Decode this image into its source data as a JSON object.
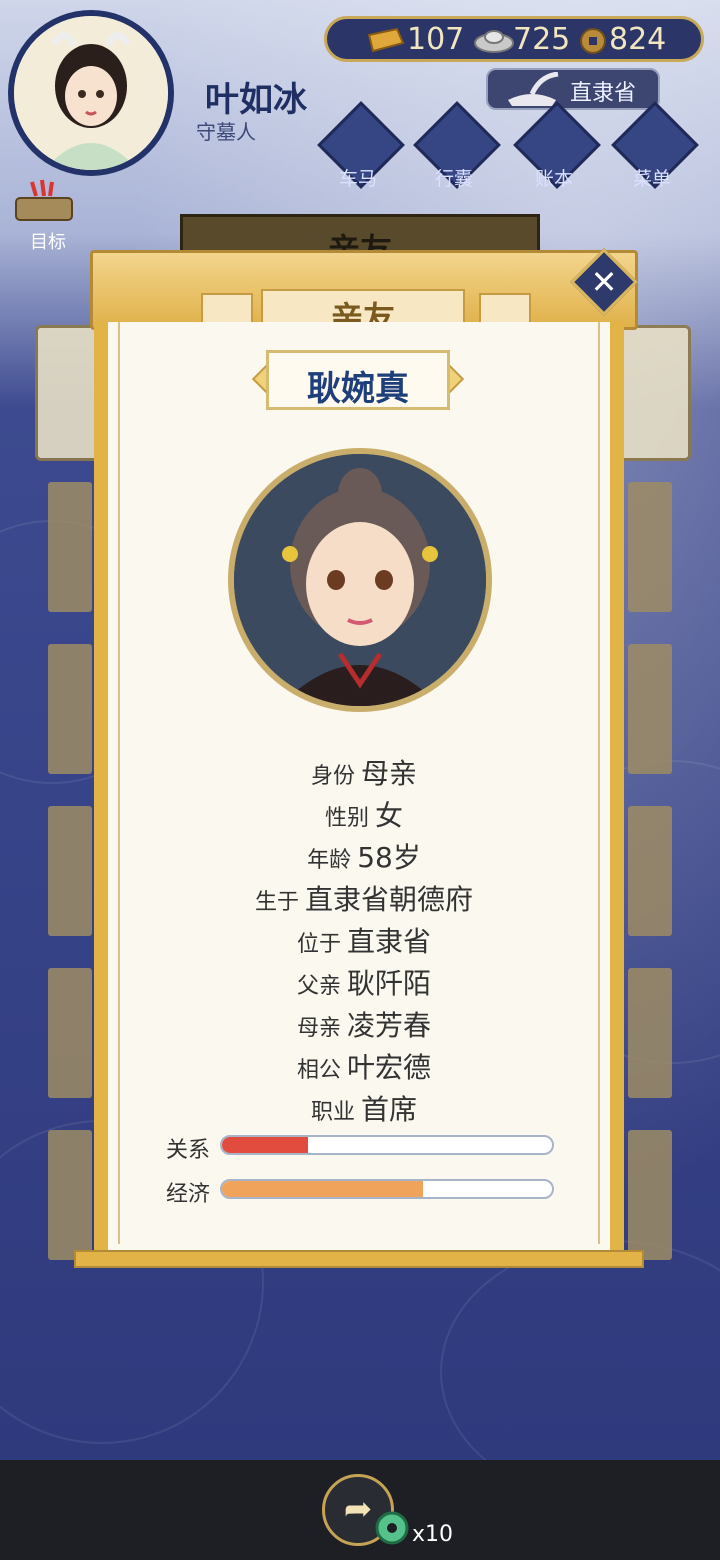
{
  "colors": {
    "background_top": "#cfd6ea",
    "background_deep": "#2f3a7d",
    "bottom_bar": "#1d1f24",
    "modal_gold": "#e2b448",
    "paper": "#fbf8ef",
    "relation_bar": "#e14c3f",
    "economy_bar": "#f0a35b"
  },
  "player": {
    "name": "叶如冰",
    "role": "守墓人",
    "avatar_icon": "player-avatar-portrait"
  },
  "currency": {
    "gold": "107",
    "silver": "725",
    "coins": "824",
    "gold_icon": "gold-bar-icon",
    "silver_icon": "silver-ingot-icon",
    "coin_icon": "copper-coin-icon"
  },
  "location": {
    "label": "直隶省",
    "icon": "inkstone-icon"
  },
  "nav": [
    {
      "label": "车马",
      "icon": "carriage-icon"
    },
    {
      "label": "行囊",
      "icon": "bag-icon"
    },
    {
      "label": "账本",
      "icon": "ledger-icon"
    },
    {
      "label": "菜单",
      "icon": "menu-dots-icon"
    }
  ],
  "goal": {
    "label": "目标",
    "icon": "goal-scroll-icon"
  },
  "background_title": "亲友",
  "modal": {
    "title": "亲友",
    "close_icon": "close-x-icon",
    "person_name": "耿婉真",
    "portrait_icon": "elder-woman-portrait",
    "details": [
      {
        "label": "身份",
        "value": "母亲"
      },
      {
        "label": "性别",
        "value": "女"
      },
      {
        "label": "年龄",
        "value": "58岁"
      },
      {
        "label": "生于",
        "value": "直隶省朝德府"
      },
      {
        "label": "位于",
        "value": "直隶省"
      },
      {
        "label": "父亲",
        "value": "耿阡陌"
      },
      {
        "label": "母亲",
        "value": "凌芳春"
      },
      {
        "label": "相公",
        "value": "叶宏德"
      },
      {
        "label": "职业",
        "value": "首席"
      }
    ],
    "relation": {
      "label": "关系",
      "percent": 26
    },
    "economy": {
      "label": "经济",
      "percent": 61
    }
  },
  "bottom": {
    "share_icon": "share-arrow-icon",
    "reward_icon": "jade-coin-icon",
    "reward_count": "x10"
  }
}
